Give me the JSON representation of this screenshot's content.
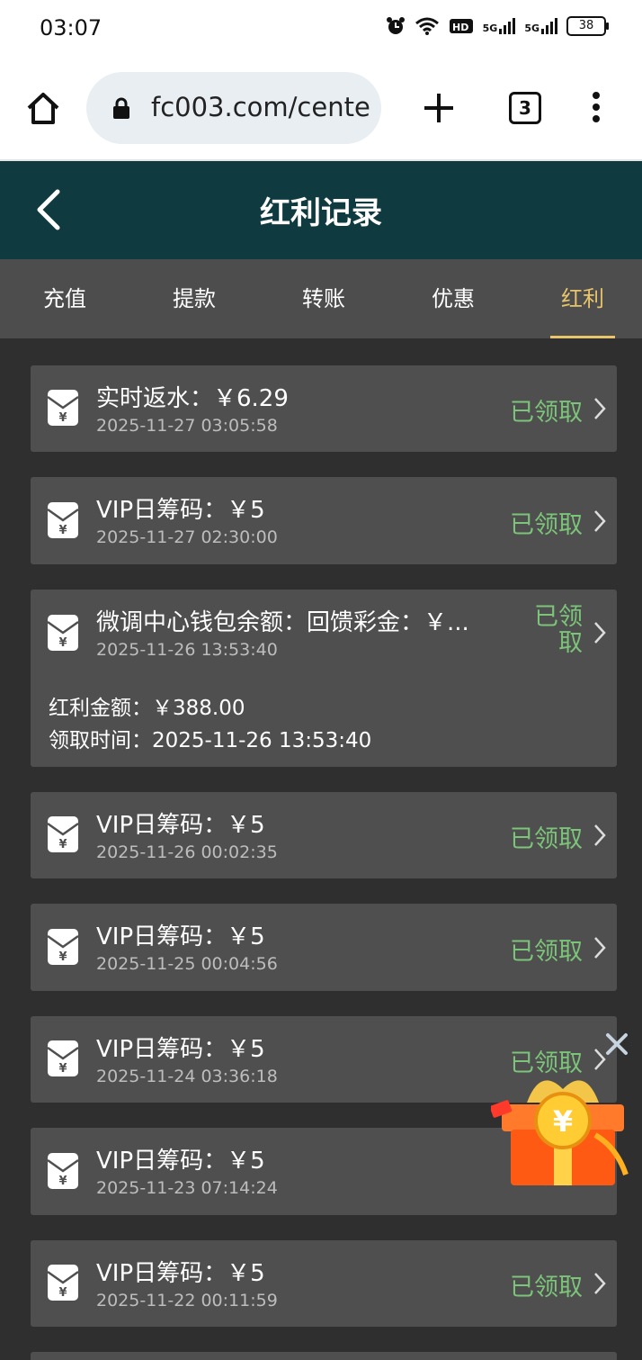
{
  "status_bar": {
    "time": "03:07",
    "battery": "38",
    "network": [
      "5G",
      "5G"
    ]
  },
  "browser": {
    "url": "fc003.com/cente",
    "tab_count": "3"
  },
  "header": {
    "title": "红利记录"
  },
  "tabs": [
    {
      "label": "充值",
      "active": false
    },
    {
      "label": "提款",
      "active": false
    },
    {
      "label": "转账",
      "active": false
    },
    {
      "label": "优惠",
      "active": false
    },
    {
      "label": "红利",
      "active": true
    }
  ],
  "records": [
    {
      "title": "实时返水：￥6.29",
      "date": "2025-11-27 03:05:58",
      "status": "已领取"
    },
    {
      "title": "VIP日筹码：￥5",
      "date": "2025-11-27 02:30:00",
      "status": "已领取"
    },
    {
      "title": "微调中心钱包余额：回馈彩金：￥...",
      "date": "2025-11-26 13:53:40",
      "status_line1": "已领",
      "status_line2": "取",
      "detail_amount": "红利金额：￥388.00",
      "detail_time": "领取时间：2025-11-26 13:53:40"
    },
    {
      "title": "VIP日筹码：￥5",
      "date": "2025-11-26 00:02:35",
      "status": "已领取"
    },
    {
      "title": "VIP日筹码：￥5",
      "date": "2025-11-25 00:04:56",
      "status": "已领取"
    },
    {
      "title": "VIP日筹码：￥5",
      "date": "2025-11-24 03:36:18",
      "status": "已领取"
    },
    {
      "title": "VIP日筹码：￥5",
      "date": "2025-11-23 07:14:24",
      "status": "已领取"
    },
    {
      "title": "VIP日筹码：￥5",
      "date": "2025-11-22 00:11:59",
      "status": "已领取"
    }
  ],
  "colors": {
    "header_bg": "#0f3a40",
    "tab_active": "#e8c46a",
    "status_green": "#7cc47a",
    "card_bg": "#4f4f4f"
  }
}
